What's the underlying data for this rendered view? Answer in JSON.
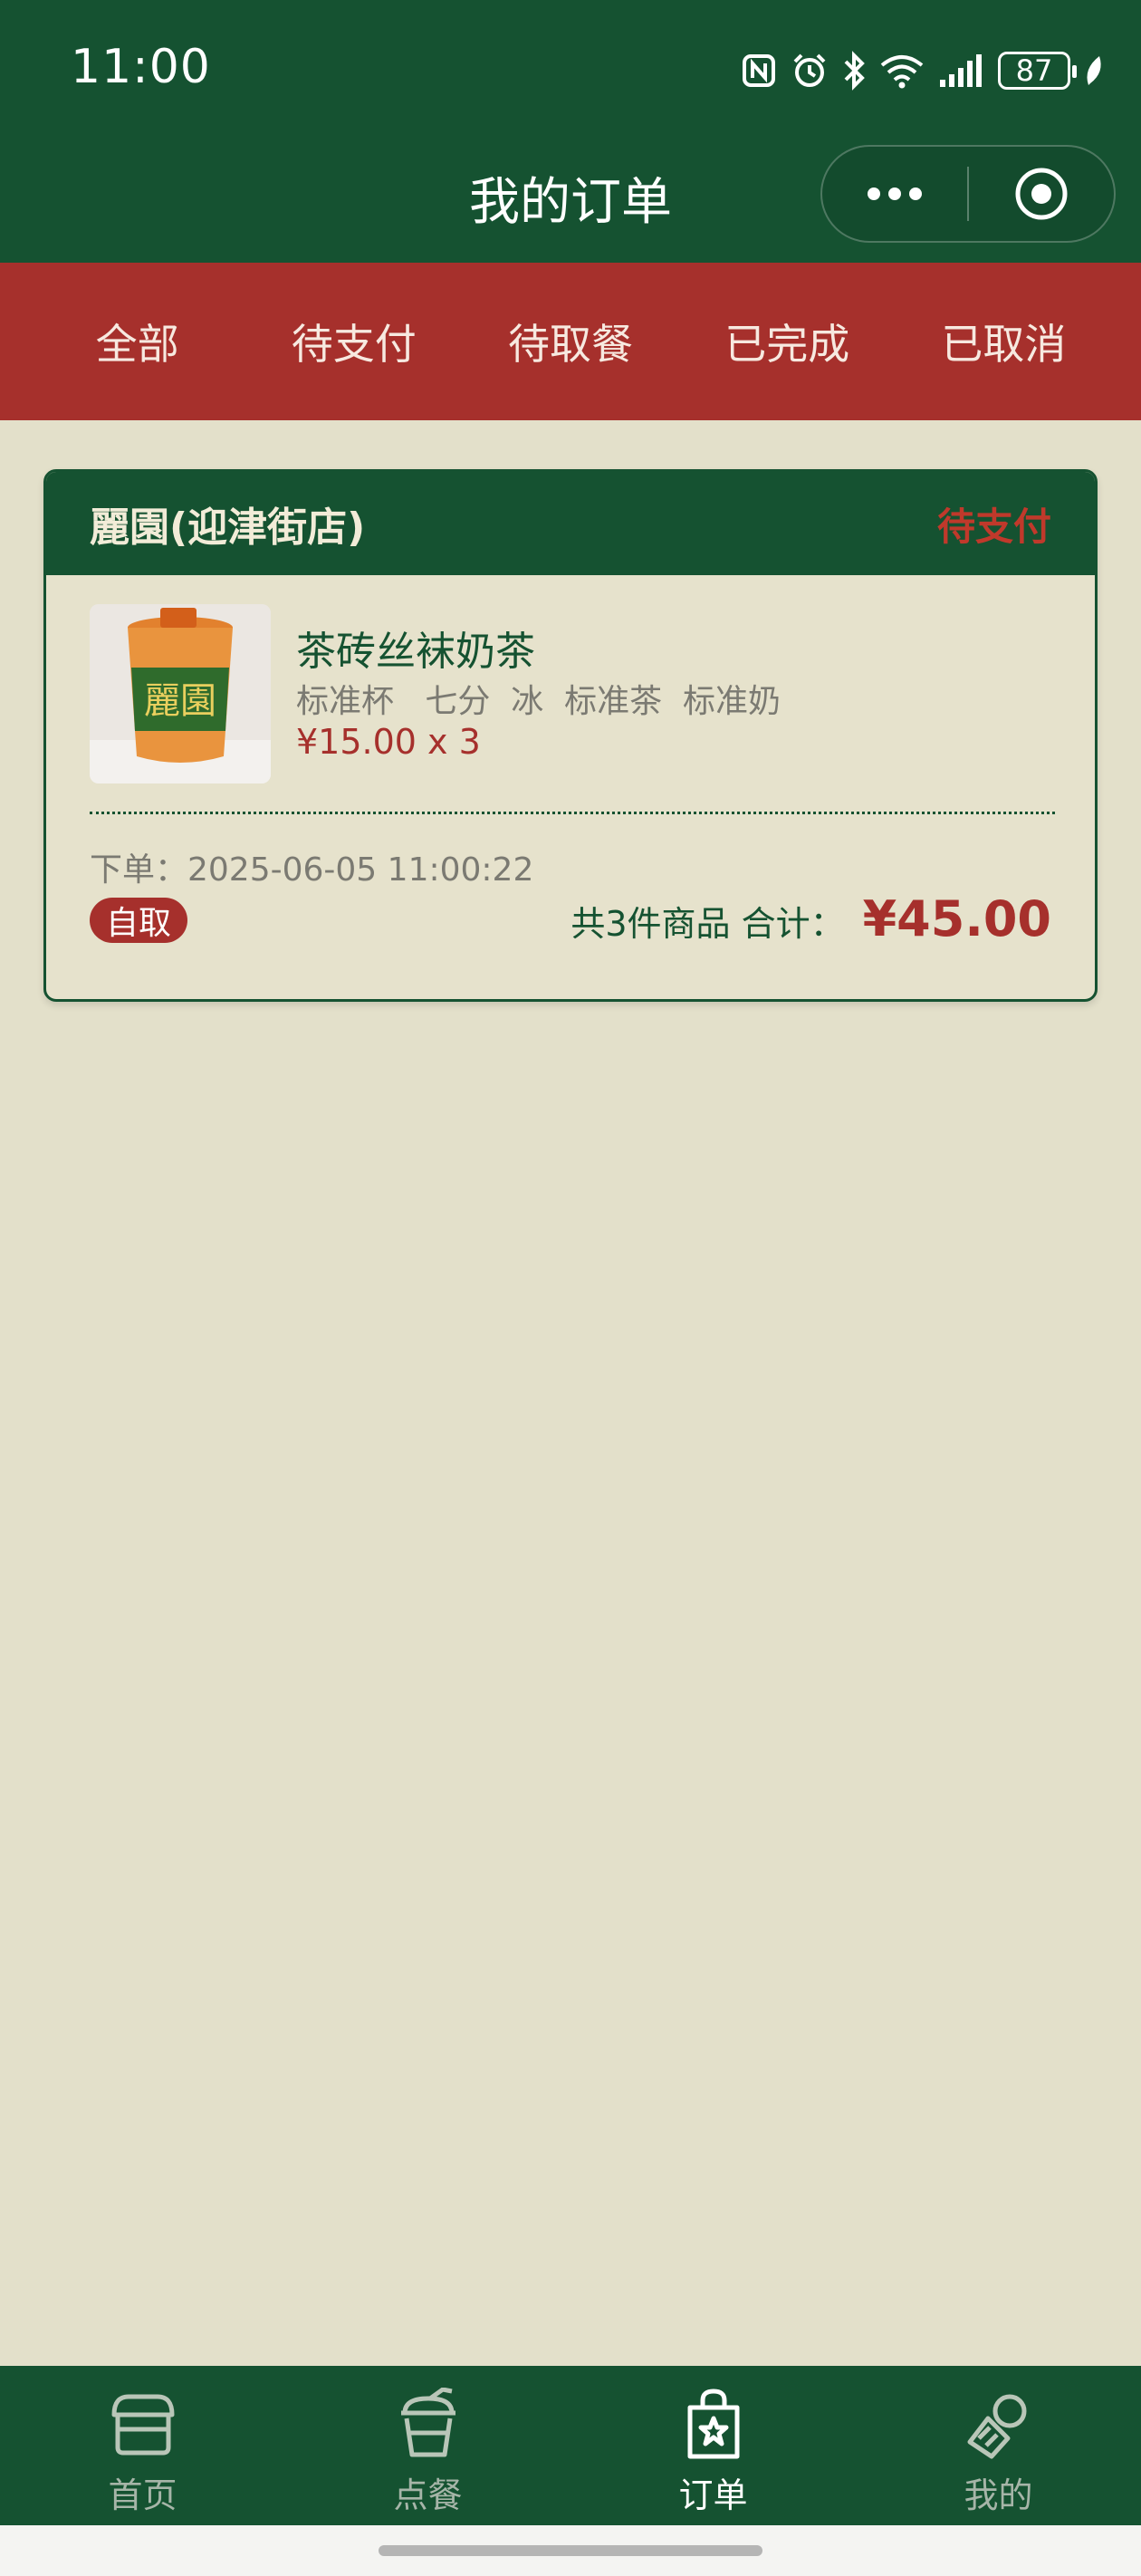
{
  "status_bar": {
    "time": "11:00",
    "battery": "87"
  },
  "header": {
    "title": "我的订单"
  },
  "tabs": [
    {
      "label": "全部"
    },
    {
      "label": "待支付"
    },
    {
      "label": "待取餐"
    },
    {
      "label": "已完成"
    },
    {
      "label": "已取消"
    }
  ],
  "order": {
    "store": "麗園(迎津街店)",
    "status": "待支付",
    "item": {
      "name": "茶砖丝袜奶茶",
      "specs": "标准杯   七分  冰  标准茶  标准奶",
      "price": "¥15.00 x 3",
      "image_text": "麗園"
    },
    "time": "下单：2025-06-05 11:00:22",
    "pickup": "自取",
    "summary": "共3件商品 合计：",
    "total": "¥45.00"
  },
  "bottom_nav": [
    {
      "label": "首页",
      "icon": "store-icon"
    },
    {
      "label": "点餐",
      "icon": "drink-cup-icon"
    },
    {
      "label": "订单",
      "icon": "shopping-bag-icon"
    },
    {
      "label": "我的",
      "icon": "profile-icon"
    }
  ],
  "colors": {
    "header_green": "#155231",
    "tab_red": "#a6302c",
    "background": "#e3e0ca"
  }
}
